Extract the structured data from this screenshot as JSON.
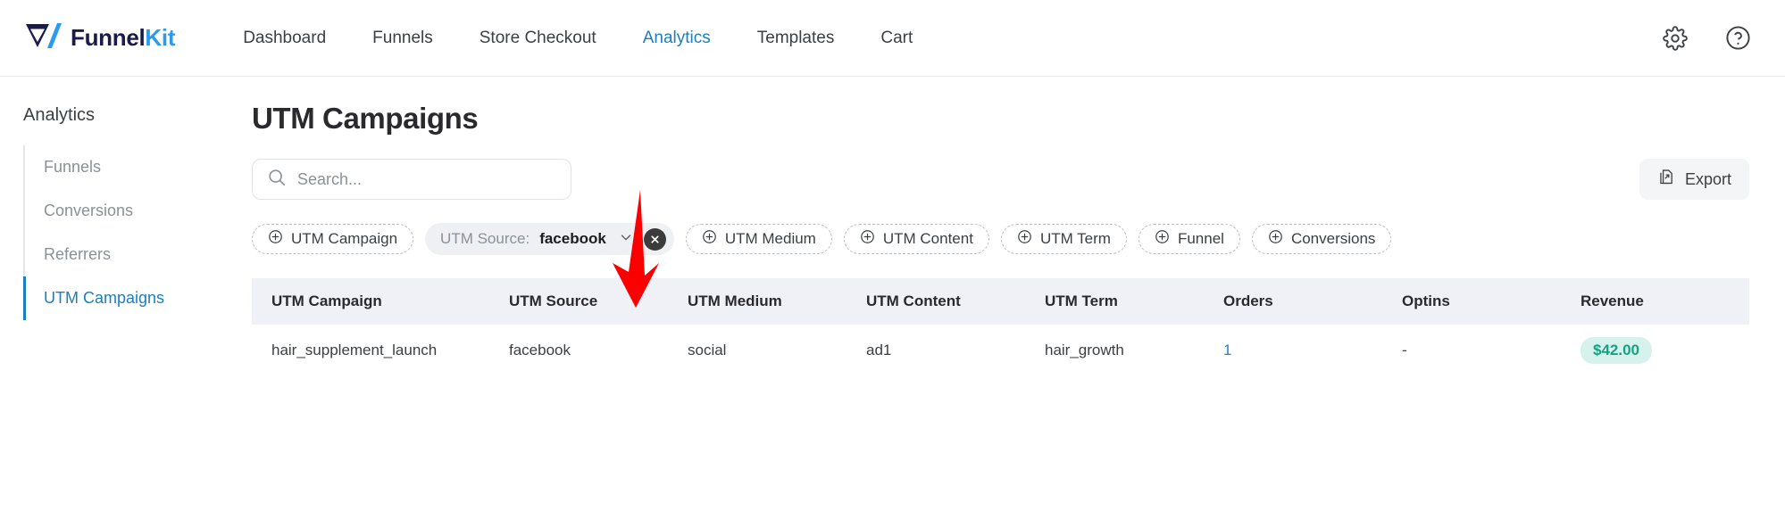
{
  "brand": {
    "name_dark": "Funnel",
    "name_accent": "Kit",
    "logo_icon": "funnelkit-v-logo-icon"
  },
  "topnav": {
    "items": [
      {
        "label": "Dashboard",
        "active": false
      },
      {
        "label": "Funnels",
        "active": false
      },
      {
        "label": "Store Checkout",
        "active": false
      },
      {
        "label": "Analytics",
        "active": true
      },
      {
        "label": "Templates",
        "active": false
      },
      {
        "label": "Cart",
        "active": false
      }
    ],
    "settings_icon": "gear-icon",
    "help_icon": "question-circle-icon"
  },
  "sidebar": {
    "title": "Analytics",
    "items": [
      {
        "label": "Funnels",
        "active": false
      },
      {
        "label": "Conversions",
        "active": false
      },
      {
        "label": "Referrers",
        "active": false
      },
      {
        "label": "UTM Campaigns",
        "active": true
      }
    ]
  },
  "main": {
    "page_title": "UTM Campaigns",
    "search": {
      "value": "",
      "placeholder": "Search...",
      "icon": "search-icon"
    },
    "export": {
      "label": "Export",
      "icon": "export-document-icon"
    }
  },
  "filters": {
    "chips": [
      {
        "label": "UTM Campaign",
        "applied": false
      },
      {
        "key": "UTM Source:",
        "value": "facebook",
        "applied": true
      },
      {
        "label": "UTM Medium",
        "applied": false
      },
      {
        "label": "UTM Content",
        "applied": false
      },
      {
        "label": "UTM Term",
        "applied": false
      },
      {
        "label": "Funnel",
        "applied": false
      },
      {
        "label": "Conversions",
        "applied": false
      }
    ]
  },
  "table": {
    "columns": [
      "UTM Campaign",
      "UTM Source",
      "UTM Medium",
      "UTM Content",
      "UTM Term",
      "Orders",
      "Optins",
      "Revenue"
    ],
    "rows": [
      {
        "campaign": "hair_supplement_launch",
        "source": "facebook",
        "medium": "social",
        "content": "ad1",
        "term": "hair_growth",
        "orders": "1",
        "optins": "-",
        "revenue": "$42.00"
      }
    ]
  },
  "annotation": {
    "arrow": "red-down-arrow-annotation"
  },
  "colors": {
    "accent_blue": "#1a7fc1",
    "brand_blue": "#2a9bf0",
    "brand_navy": "#1b1b4b",
    "revenue_badge_bg": "#d7f2ec",
    "revenue_badge_text": "#12a383",
    "annotation_red": "#fb0000"
  }
}
